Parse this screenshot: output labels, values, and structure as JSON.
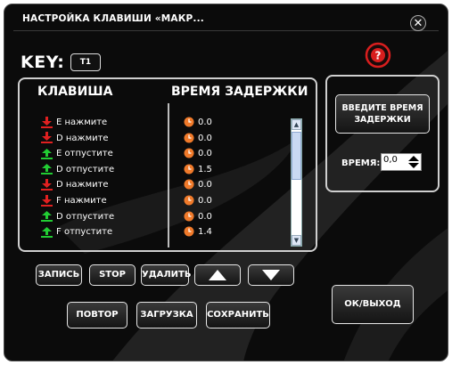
{
  "window": {
    "title": "НАСТРОЙКА КЛАВИШИ «МАКР...",
    "close_glyph": "✕"
  },
  "key": {
    "label": "KEY:",
    "value": "T1"
  },
  "table": {
    "col_key": "КЛАВИША",
    "col_delay": "ВРЕМЯ ЗАДЕРЖКИ",
    "rows": [
      {
        "dir": "down",
        "key": "E",
        "action": "нажмите",
        "delay": "0.0"
      },
      {
        "dir": "down",
        "key": "D",
        "action": "нажмите",
        "delay": "0.0"
      },
      {
        "dir": "up",
        "key": "E",
        "action": "отпустите",
        "delay": "0.0"
      },
      {
        "dir": "up",
        "key": "D",
        "action": "отпустите",
        "delay": "1.5"
      },
      {
        "dir": "down",
        "key": "D",
        "action": "нажмите",
        "delay": "0.0"
      },
      {
        "dir": "down",
        "key": "F",
        "action": "нажмите",
        "delay": "0.0"
      },
      {
        "dir": "up",
        "key": "D",
        "action": "отпустите",
        "delay": "0.0"
      },
      {
        "dir": "up",
        "key": "F",
        "action": "отпустите",
        "delay": "1.4"
      }
    ]
  },
  "buttons": {
    "record": "ЗАПИСЬ",
    "stop": "STOP",
    "delete": "УДАЛИТЬ",
    "repeat": "ПОВТОР",
    "load": "ЗАГРУЗКА",
    "save": "СОХРАНИТЬ",
    "ok": "ОК/ВЫХОД"
  },
  "delay_panel": {
    "enter_button": "ВВЕДИТЕ ВРЕМЯ ЗАДЕРЖКИ",
    "time_label": "ВРЕМЯ:",
    "time_value": "0,0"
  },
  "colors": {
    "down_arrow": "#e02020",
    "up_arrow": "#22cc33",
    "clock": "#f07a2a",
    "help": "#d81e1e"
  }
}
